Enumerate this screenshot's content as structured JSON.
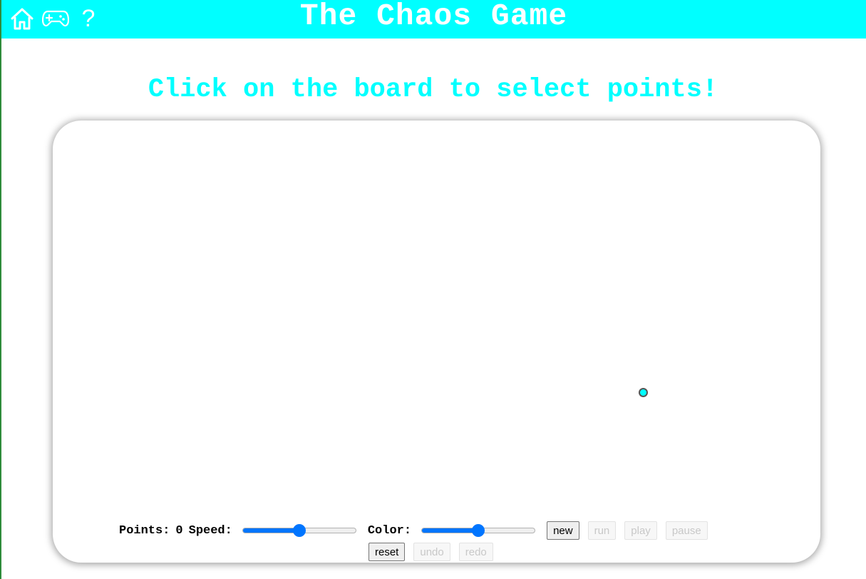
{
  "header": {
    "title": "The Chaos Game",
    "nav": {
      "home_icon": "home-icon",
      "games_icon": "gamepad-icon",
      "help_label": "?"
    },
    "background": "#00ffff"
  },
  "instruction": "Click on the board to select points!",
  "board": {
    "selected_point_color": "#00ffff"
  },
  "controls": {
    "points_label": "Points:",
    "points_value": "0",
    "speed_label": "Speed:",
    "speed_value": 0.5,
    "color_label": "Color:",
    "color_value": 0.5,
    "buttons": {
      "new": "new",
      "run": "run",
      "play": "play",
      "pause": "pause",
      "reset": "reset",
      "undo": "undo",
      "redo": "redo"
    },
    "disabled": [
      "run",
      "play",
      "pause",
      "undo",
      "redo"
    ]
  }
}
